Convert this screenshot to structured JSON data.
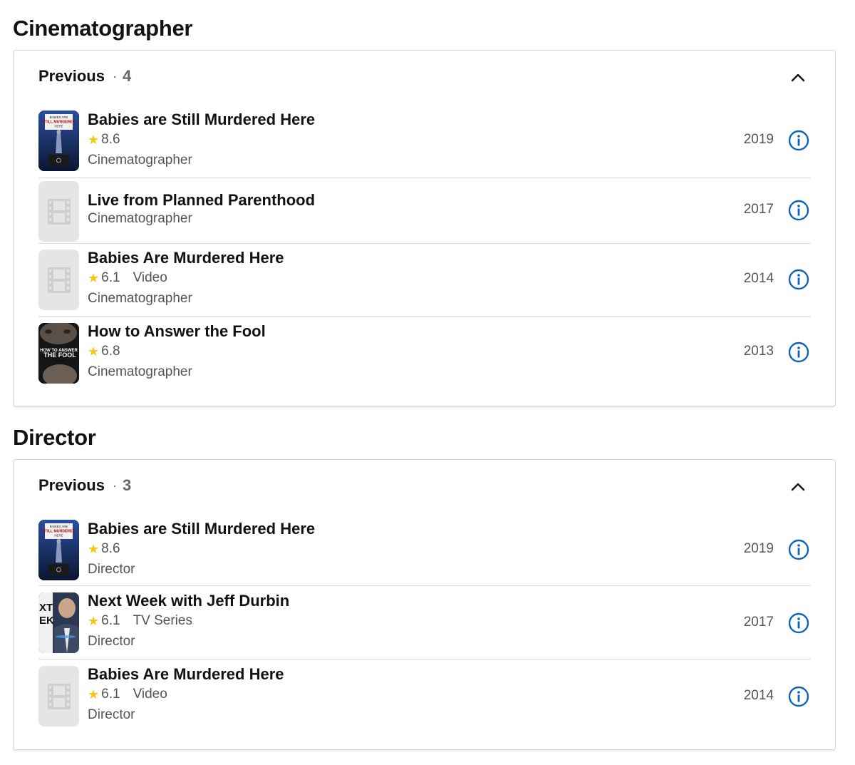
{
  "sections": [
    {
      "title": "Cinematographer",
      "header_label": "Previous",
      "count": "4",
      "items": [
        {
          "title": "Babies are Still Murdered Here",
          "rating": "8.6",
          "kind": "",
          "role": "Cinematographer",
          "year": "2019",
          "poster": "babies-still"
        },
        {
          "title": "Live from Planned Parenthood",
          "rating": "",
          "kind": "",
          "role": "Cinematographer",
          "year": "2017",
          "poster": "placeholder"
        },
        {
          "title": "Babies Are Murdered Here",
          "rating": "6.1",
          "kind": "Video",
          "role": "Cinematographer",
          "year": "2014",
          "poster": "placeholder"
        },
        {
          "title": "How to Answer the Fool",
          "rating": "6.8",
          "kind": "",
          "role": "Cinematographer",
          "year": "2013",
          "poster": "fool"
        }
      ]
    },
    {
      "title": "Director",
      "header_label": "Previous",
      "count": "3",
      "items": [
        {
          "title": "Babies are Still Murdered Here",
          "rating": "8.6",
          "kind": "",
          "role": "Director",
          "year": "2019",
          "poster": "babies-still"
        },
        {
          "title": "Next Week with Jeff Durbin",
          "rating": "6.1",
          "kind": "TV Series",
          "role": "Director",
          "year": "2017",
          "poster": "next-week"
        },
        {
          "title": "Babies Are Murdered Here",
          "rating": "6.1",
          "kind": "Video",
          "role": "Director",
          "year": "2014",
          "poster": "placeholder"
        }
      ]
    }
  ],
  "poster_text": {
    "babies_still": [
      "BABIES ARE",
      "STILL MURDERED",
      "HERE"
    ],
    "fool": [
      "HOW TO ANSWER",
      "THE FOOL"
    ],
    "next_week": [
      "XT",
      "EK"
    ]
  },
  "icons": {
    "star": "star-icon",
    "info": "info-circle-icon",
    "collapse": "chevron-up-icon",
    "placeholder": "film-strip-icon"
  },
  "colors": {
    "star": "#f5c518",
    "info": "#0e63be",
    "text": "#121212",
    "muted": "#555555"
  }
}
